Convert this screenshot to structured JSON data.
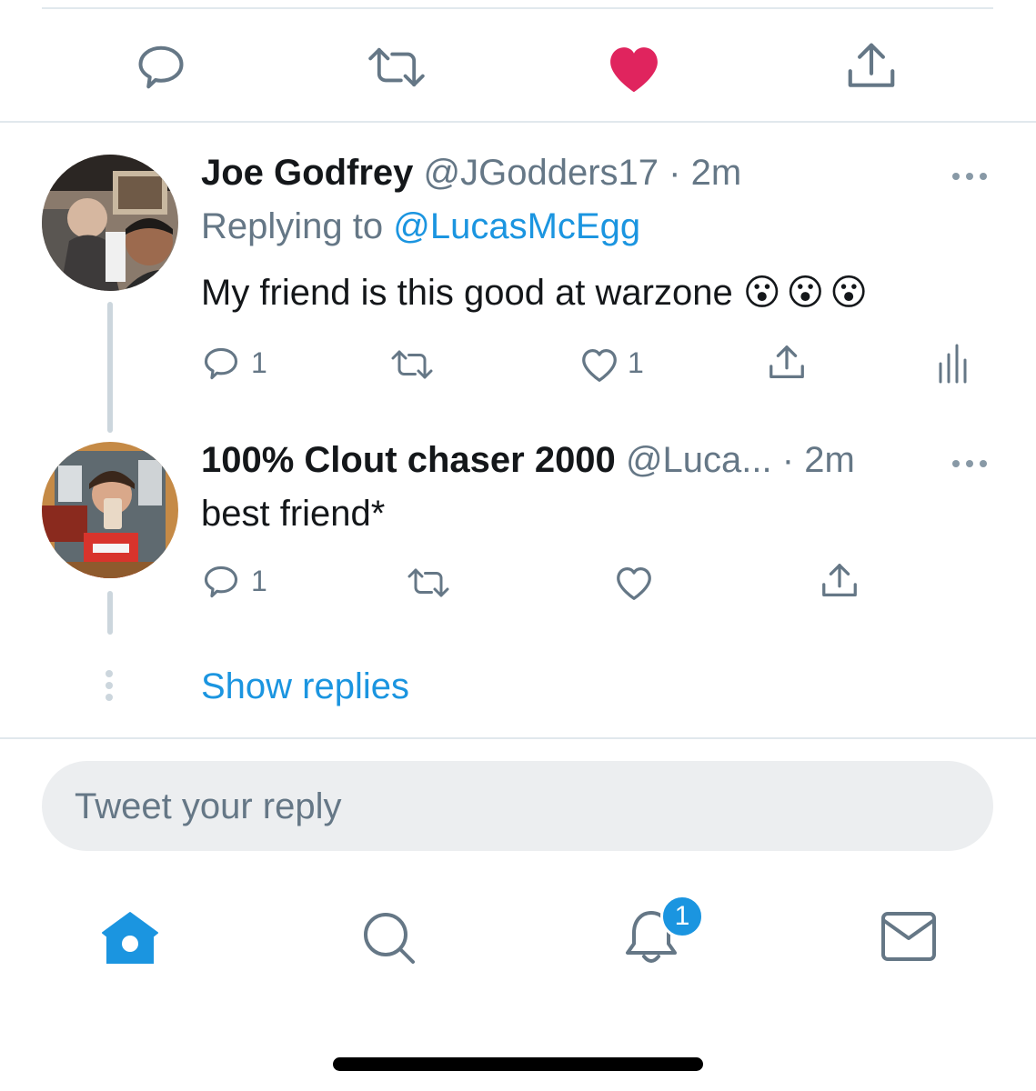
{
  "colors": {
    "accent": "#1b95e0",
    "liked": "#e0245e",
    "secondary_text": "#657786",
    "divider": "#e1e8ed"
  },
  "main_tweet_actions": {
    "icons": [
      "reply-icon",
      "retweet-icon",
      "like-icon-filled",
      "share-icon"
    ]
  },
  "replies": [
    {
      "display_name": "Joe Godfrey",
      "handle": "@JGodders17",
      "separator": "·",
      "time": "2m",
      "replying_to_label": "Replying to",
      "replying_to_handle": "@LucasMcEgg",
      "text": "My friend is this good at warzone",
      "emojis": "😮😮😮",
      "reply_count": "1",
      "like_count": "1"
    },
    {
      "display_name": "100% Clout chaser 2000",
      "handle": "@Luca...",
      "separator": "·",
      "time": "2m",
      "text": "best friend*",
      "reply_count": "1"
    }
  ],
  "show_replies_label": "Show replies",
  "reply_box": {
    "placeholder": "Tweet your reply"
  },
  "tab_bar": {
    "notifications_badge": "1",
    "icons": [
      "home-icon",
      "search-icon",
      "notifications-icon",
      "messages-icon"
    ]
  }
}
